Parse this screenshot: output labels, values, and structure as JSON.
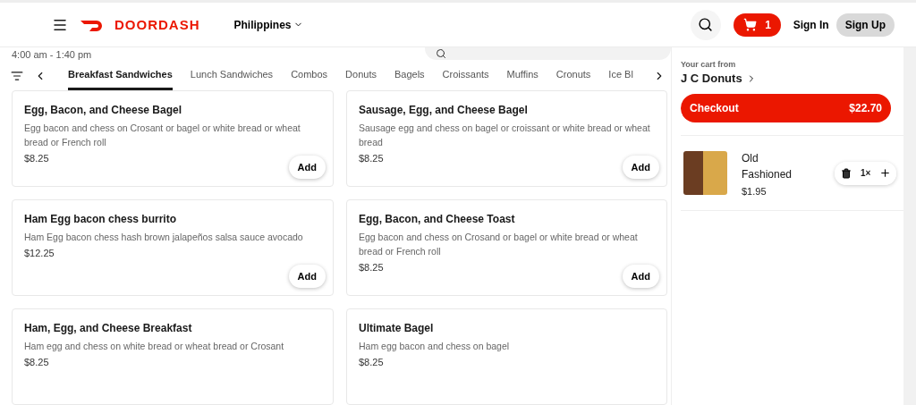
{
  "header": {
    "brand": "DOORDASH",
    "location": "Philippines",
    "cart_count": "1",
    "sign_in": "Sign In",
    "sign_up": "Sign Up"
  },
  "store": {
    "hours": "4:00 am - 1:40 pm"
  },
  "categories": [
    {
      "label": "Breakfast Sandwiches",
      "selected": true
    },
    {
      "label": "Lunch Sandwiches",
      "selected": false
    },
    {
      "label": "Combos",
      "selected": false
    },
    {
      "label": "Donuts",
      "selected": false
    },
    {
      "label": "Bagels",
      "selected": false
    },
    {
      "label": "Croissants",
      "selected": false
    },
    {
      "label": "Muffins",
      "selected": false
    },
    {
      "label": "Cronuts",
      "selected": false
    },
    {
      "label": "Ice Bl",
      "selected": false
    }
  ],
  "items": [
    {
      "name": "Egg, Bacon, and Cheese Bagel",
      "description": "Egg bacon and chess on Crosant or bagel or white bread or wheat bread or French roll",
      "price": "$8.25",
      "button": "Add"
    },
    {
      "name": "Sausage, Egg, and Cheese Bagel",
      "description": "Sausage egg and chess on bagel or croissant or white bread or wheat bread",
      "price": "$8.25",
      "button": "Add"
    },
    {
      "name": "Ham Egg bacon chess burrito",
      "description": "Ham Egg bacon chess hash brown jalapeños salsa sauce avocado",
      "price": "$12.25",
      "button": "Add"
    },
    {
      "name": "Egg, Bacon, and Cheese Toast",
      "description": "Egg bacon and chess on Crosand or bagel or white bread or wheat bread or French roll",
      "price": "$8.25",
      "button": "Add"
    },
    {
      "name": "Ham, Egg, and Cheese Breakfast",
      "description": "Ham egg and chess on white bread or wheat bread or Crosant",
      "price": "$8.25"
    },
    {
      "name": "Ultimate Bagel",
      "description": "Ham egg bacon and chess on bagel",
      "price": "$8.25"
    }
  ],
  "cart": {
    "label": "Your cart from",
    "store": "J C Donuts",
    "checkout": "Checkout",
    "total": "$22.70",
    "items": [
      {
        "name": "Old Fashioned",
        "price": "$1.95",
        "quantity": "1×"
      }
    ]
  }
}
